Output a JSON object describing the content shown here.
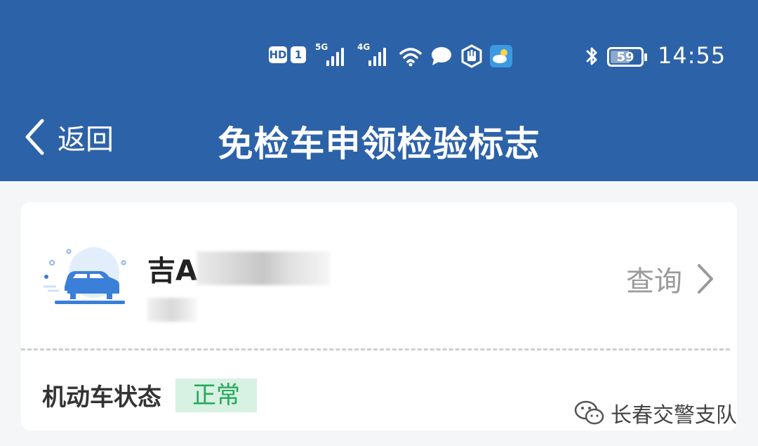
{
  "status_bar": {
    "hd": "HD",
    "sim": "1",
    "net1": "5G",
    "net2": "4G",
    "battery": "59",
    "battery_level": 0.59,
    "time": "14:55"
  },
  "nav": {
    "back_label": "返回",
    "title": "免检车申领检验标志"
  },
  "vehicle": {
    "plate_prefix": "吉A",
    "query_label": "查询"
  },
  "status": {
    "label": "机动车状态",
    "value": "正常"
  },
  "watermark": {
    "text": "长春交警支队"
  },
  "colors": {
    "primary": "#2c62a8",
    "badge_bg": "#d7f2e2",
    "badge_text": "#26a65b"
  }
}
